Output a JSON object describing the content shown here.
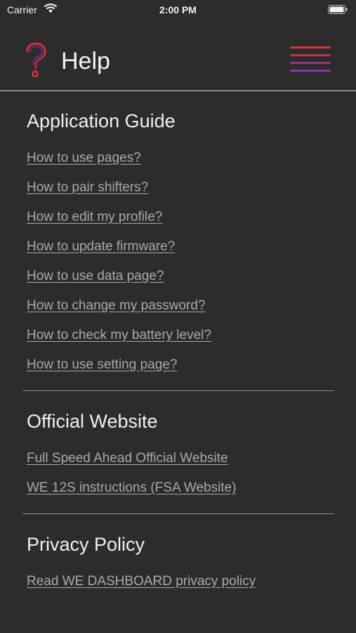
{
  "status_bar": {
    "carrier": "Carrier",
    "time": "2:00 PM"
  },
  "header": {
    "title": "Help",
    "logo_icon": "question-mark-icon",
    "menu_icon": "hamburger-menu-icon"
  },
  "colors": {
    "accent_red": "#e0303c",
    "accent_purple": "#8a2fc0",
    "background": "#2c2c2d"
  },
  "sections": {
    "guide": {
      "title": "Application Guide",
      "links": [
        "How to use pages?",
        "How to pair shifters?",
        "How to edit my profile?",
        "How to update firmware?",
        "How to use data page?",
        "How to change my password?",
        "How to check my battery level?",
        "How to use setting page?"
      ]
    },
    "website": {
      "title": "Official Website",
      "links": [
        "Full Speed Ahead Official Website",
        "WE 12S instructions (FSA Website)"
      ]
    },
    "privacy": {
      "title": "Privacy Policy",
      "links": [
        "Read WE DASHBOARD privacy policy"
      ]
    }
  }
}
